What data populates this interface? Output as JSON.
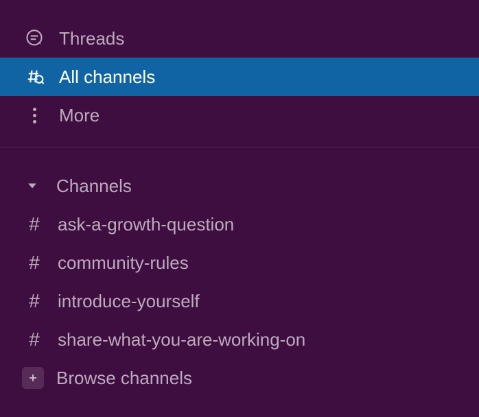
{
  "nav": {
    "threads": "Threads",
    "allChannels": "All channels",
    "more": "More"
  },
  "channelsSection": {
    "header": "Channels",
    "items": [
      {
        "name": "ask-a-growth-question"
      },
      {
        "name": "community-rules"
      },
      {
        "name": "introduce-yourself"
      },
      {
        "name": "share-what-you-are-working-on"
      }
    ],
    "browse": "Browse channels"
  }
}
